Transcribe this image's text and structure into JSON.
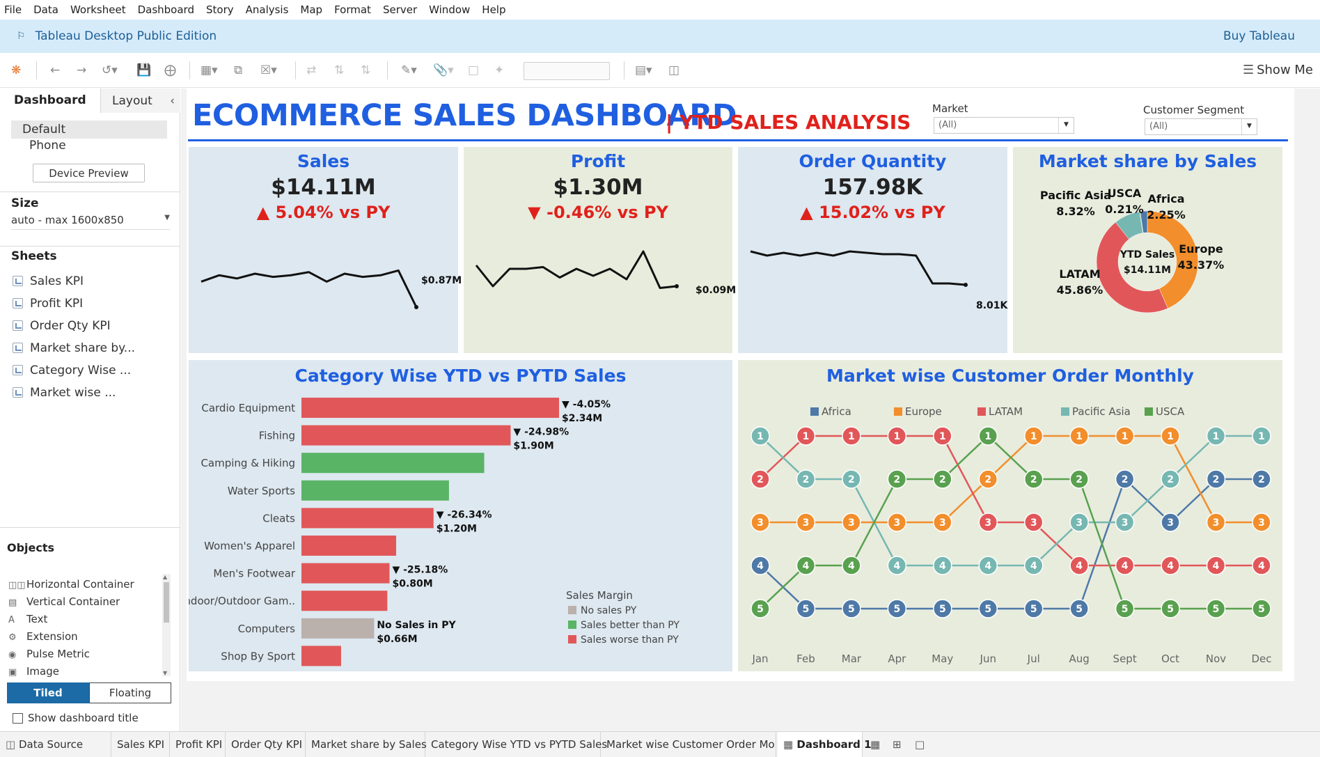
{
  "menu": [
    "File",
    "Data",
    "Worksheet",
    "Dashboard",
    "Story",
    "Analysis",
    "Map",
    "Format",
    "Server",
    "Window",
    "Help"
  ],
  "banner": {
    "title": "Tableau Desktop Public Edition",
    "buy": "Buy Tableau"
  },
  "toolbar": {
    "show_me": "Show Me"
  },
  "left_pane": {
    "tabs": [
      "Dashboard",
      "Layout"
    ],
    "devices": [
      "Default",
      "Phone"
    ],
    "device_preview": "Device Preview",
    "size_header": "Size",
    "size_value": "auto - max 1600x850",
    "sheets_header": "Sheets",
    "sheets": [
      "Sales KPI",
      "Profit KPI",
      "Order Qty KPI",
      "Market share by...",
      "Category Wise ...",
      "Market wise ..."
    ],
    "objects_header": "Objects",
    "objects": [
      "Horizontal Container",
      "Vertical Container",
      "Text",
      "Extension",
      "Pulse Metric",
      "Image"
    ],
    "tiled": "Tiled",
    "floating": "Floating",
    "show_title": "Show dashboard title"
  },
  "dashboard": {
    "title": "ECOMMERCE SALES DASHBOARD",
    "subtitle": "| YTD SALES ANALYSIS",
    "filters": [
      {
        "label": "Market",
        "value": "(All)"
      },
      {
        "label": "Customer Segment",
        "value": "(All)"
      }
    ],
    "kpis": [
      {
        "title": "Sales",
        "value": "$14.11M",
        "delta": "5.04%",
        "direction": "up",
        "vs": "vs PY",
        "spark": [
          19,
          15,
          17,
          14,
          16,
          15,
          13,
          19,
          14,
          16,
          15,
          12,
          35
        ],
        "end_label": "$0.87M"
      },
      {
        "title": "Profit",
        "value": "$1.30M",
        "delta": "-0.46%",
        "direction": "down",
        "vs": "vs PY",
        "spark": [
          24,
          12,
          22,
          22,
          23,
          17,
          22,
          18,
          22,
          16,
          32,
          11,
          12
        ],
        "end_label": "$0.09M"
      },
      {
        "title": "Order Quantity",
        "value": "157.98K",
        "delta": "15.02%",
        "direction": "up",
        "vs": "vs PY",
        "spark": [
          40,
          37,
          39,
          37,
          39,
          37,
          40,
          39,
          38,
          38,
          37,
          17,
          17,
          16
        ],
        "end_label": "8.01K"
      }
    ],
    "market_share": {
      "title": "Market share by Sales",
      "center_label": "YTD Sales",
      "center_value": "$14.11M",
      "slices": [
        {
          "name": "Europe",
          "pct": 43.37,
          "label": "43.37%",
          "color": "#f28e2b"
        },
        {
          "name": "LATAM",
          "pct": 45.86,
          "label": "45.86%",
          "color": "#e15759"
        },
        {
          "name": "Pacific Asia",
          "pct": 8.32,
          "label": "8.32%",
          "color": "#76b7b2"
        },
        {
          "name": "USCA",
          "pct": 0.21,
          "label": "0.21%",
          "color": "#59a14f"
        },
        {
          "name": "Africa",
          "pct": 2.25,
          "label": "2.25%",
          "color": "#4e79a7"
        }
      ]
    },
    "category": {
      "title": "Category Wise YTD vs PYTD Sales",
      "legend_title": "Sales Margin",
      "legend": [
        {
          "label": "No sales PY",
          "color": "#bab0ac"
        },
        {
          "label": "Sales better than PY",
          "color": "#59b466"
        },
        {
          "label": "Sales worse than PY",
          "color": "#e15759"
        }
      ],
      "rows": [
        {
          "name": "Cardio Equipment",
          "value": 2.34,
          "status": "worse",
          "pct": "▼ -4.05%",
          "amt": "$2.34M"
        },
        {
          "name": "Fishing",
          "value": 1.9,
          "status": "worse",
          "pct": "▼ -24.98%",
          "amt": "$1.90M"
        },
        {
          "name": "Camping & Hiking",
          "value": 1.66,
          "status": "better",
          "pct": "",
          "amt": ""
        },
        {
          "name": "Water Sports",
          "value": 1.34,
          "status": "better",
          "pct": "",
          "amt": ""
        },
        {
          "name": "Cleats",
          "value": 1.2,
          "status": "worse",
          "pct": "▼ -26.34%",
          "amt": "$1.20M"
        },
        {
          "name": "Women's Apparel",
          "value": 0.86,
          "status": "worse",
          "pct": "",
          "amt": ""
        },
        {
          "name": "Men's Footwear",
          "value": 0.8,
          "status": "worse",
          "pct": "▼ -25.18%",
          "amt": "$0.80M"
        },
        {
          "name": "Indoor/Outdoor Gam..",
          "value": 0.78,
          "status": "worse",
          "pct": "",
          "amt": ""
        },
        {
          "name": "Computers",
          "value": 0.66,
          "status": "nopy",
          "pct": "No Sales in PY",
          "amt": "$0.66M"
        },
        {
          "name": "Shop By Sport",
          "value": 0.36,
          "status": "worse",
          "pct": "",
          "amt": ""
        }
      ]
    },
    "market_rank": {
      "title": "Market wise Customer Order Monthly",
      "months": [
        "Jan",
        "Feb",
        "Mar",
        "Apr",
        "May",
        "Jun",
        "Jul",
        "Aug",
        "Sept",
        "Oct",
        "Nov",
        "Dec"
      ],
      "series": [
        {
          "name": "Africa",
          "color": "#4e79a7",
          "ranks": [
            4,
            5,
            5,
            5,
            5,
            5,
            5,
            5,
            2,
            3,
            2,
            2
          ]
        },
        {
          "name": "Europe",
          "color": "#f28e2b",
          "ranks": [
            3,
            3,
            3,
            3,
            3,
            2,
            1,
            1,
            1,
            1,
            3,
            3
          ]
        },
        {
          "name": "LATAM",
          "color": "#e15759",
          "ranks": [
            2,
            1,
            1,
            1,
            1,
            3,
            3,
            4,
            4,
            4,
            4,
            4
          ]
        },
        {
          "name": "Pacific Asia",
          "color": "#76b7b2",
          "ranks": [
            1,
            2,
            2,
            4,
            4,
            4,
            4,
            3,
            3,
            2,
            1,
            1
          ]
        },
        {
          "name": "USCA",
          "color": "#59a14f",
          "ranks": [
            5,
            4,
            4,
            2,
            2,
            1,
            2,
            2,
            5,
            5,
            5,
            5
          ]
        }
      ]
    }
  },
  "tabs": [
    "Data Source",
    "Sales KPI",
    "Profit KPI",
    "Order Qty KPI",
    "Market share by Sales",
    "Category Wise YTD vs PYTD Sales",
    "Market wise Customer Order Mo...",
    "Dashboard 1"
  ],
  "colors": {
    "brand_blue": "#1f5fe0",
    "accent_red": "#e0211b",
    "panel_blue": "#dde8f0",
    "panel_green": "#e8ecdd"
  }
}
